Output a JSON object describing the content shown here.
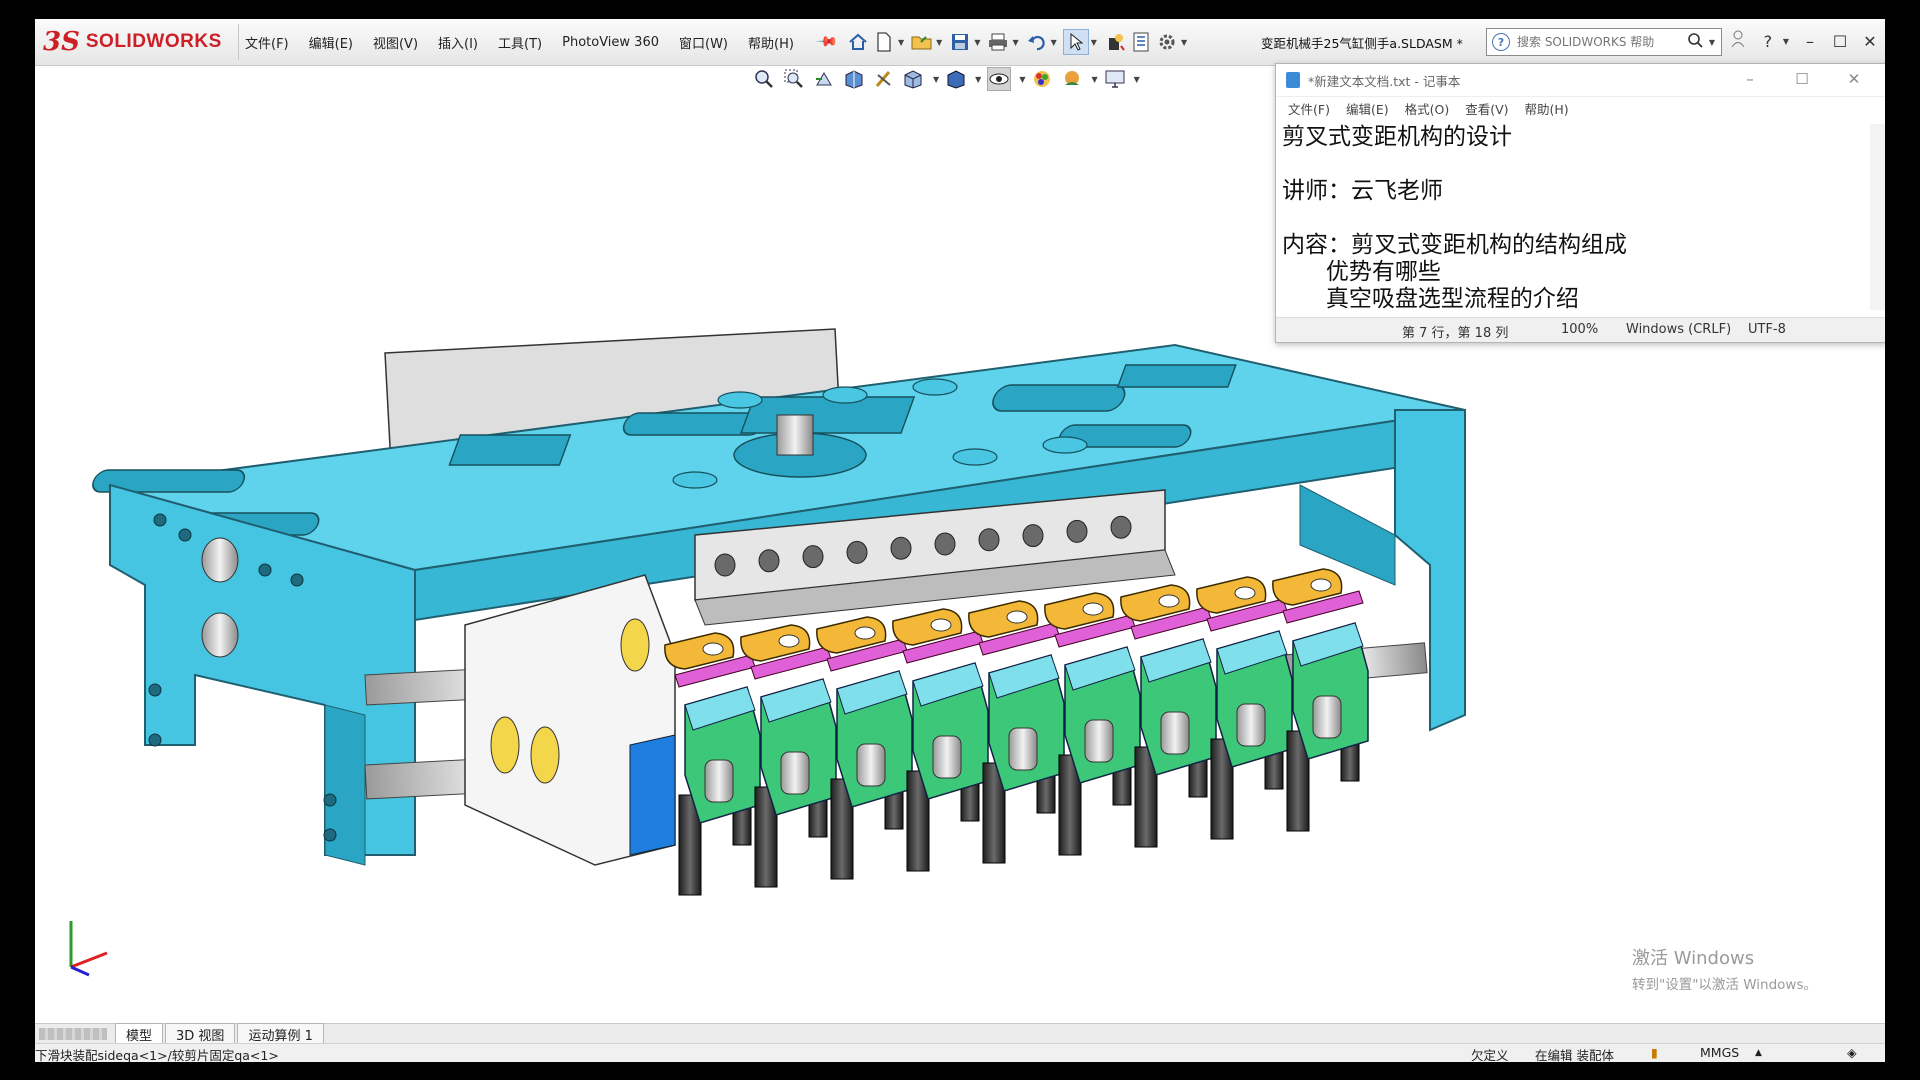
{
  "app": {
    "logo_prefix": "3S",
    "logo_name": "SOLIDWORKS",
    "menu": [
      "文件(F)",
      "编辑(E)",
      "视图(V)",
      "插入(I)",
      "工具(T)",
      "PhotoView 360",
      "窗口(W)",
      "帮助(H)"
    ],
    "document_title": "变距机械手25气缸侧手a.SLDASM *",
    "search_placeholder": "搜索 SOLIDWORKS 帮助",
    "colors": {
      "accent": "#cc1f26",
      "frame": "#40c4e0",
      "module": "#3cc878",
      "lever": "#f4b838",
      "link": "#e060d8"
    }
  },
  "notepad": {
    "title": "*新建文本文档.txt - 记事本",
    "menu": [
      "文件(F)",
      "编辑(E)",
      "格式(O)",
      "查看(V)",
      "帮助(H)"
    ],
    "lines": [
      "剪叉式变距机构的设计",
      "",
      "讲师：云飞老师",
      "",
      "内容：剪叉式变距机构的结构组成",
      "      优势有哪些",
      "      真空吸盘选型流程的介绍"
    ],
    "status": {
      "position": "第 7 行，第 18 列",
      "zoom": "100%",
      "eol": "Windows (CRLF)",
      "encoding": "UTF-8"
    }
  },
  "watermark": {
    "line1": "激活 Windows",
    "line2": "转到\"设置\"以激活 Windows。"
  },
  "tabs": [
    "模型",
    "3D 视图",
    "运动算例 1"
  ],
  "statusbar": {
    "path": "下滑块装配sideqa<1>/较剪片固定qa<1>",
    "state": "欠定义",
    "mode": "在编辑 装配体",
    "units": "MMGS"
  }
}
